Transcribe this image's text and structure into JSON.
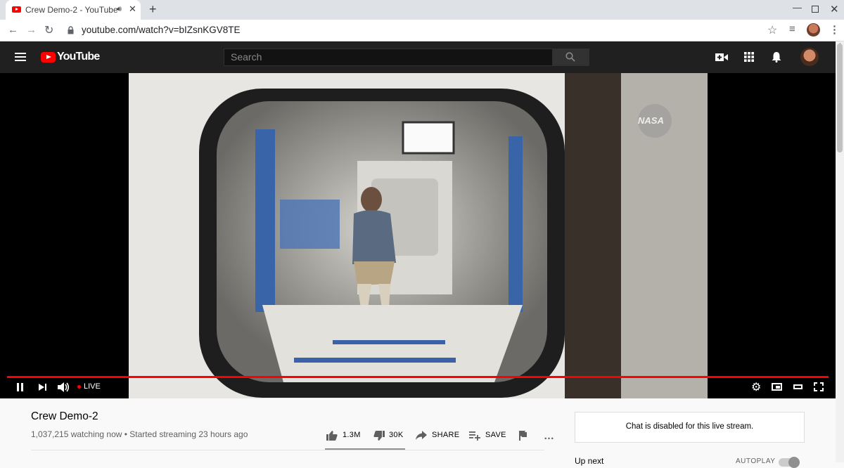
{
  "browser": {
    "tab_title": "Crew Demo-2 - YouTube",
    "url": "youtube.com/watch?v=bIZsnKGV8TE"
  },
  "header": {
    "logo_text": "YouTube",
    "search_placeholder": "Search"
  },
  "player": {
    "live_label": "LIVE",
    "watermark": "NASA"
  },
  "video": {
    "title": "Crew Demo-2",
    "meta": "1,037,215 watching now • Started streaming 23 hours ago",
    "like_count": "1.3M",
    "dislike_count": "30K",
    "share_label": "SHARE",
    "save_label": "SAVE"
  },
  "chat": {
    "disabled_text": "Chat is disabled for this live stream."
  },
  "sidebar": {
    "up_next": "Up next",
    "autoplay": "AUTOPLAY"
  },
  "colors": {
    "brand_red": "#ff0000",
    "header_bg": "#202020",
    "progress": "#ff0000"
  }
}
